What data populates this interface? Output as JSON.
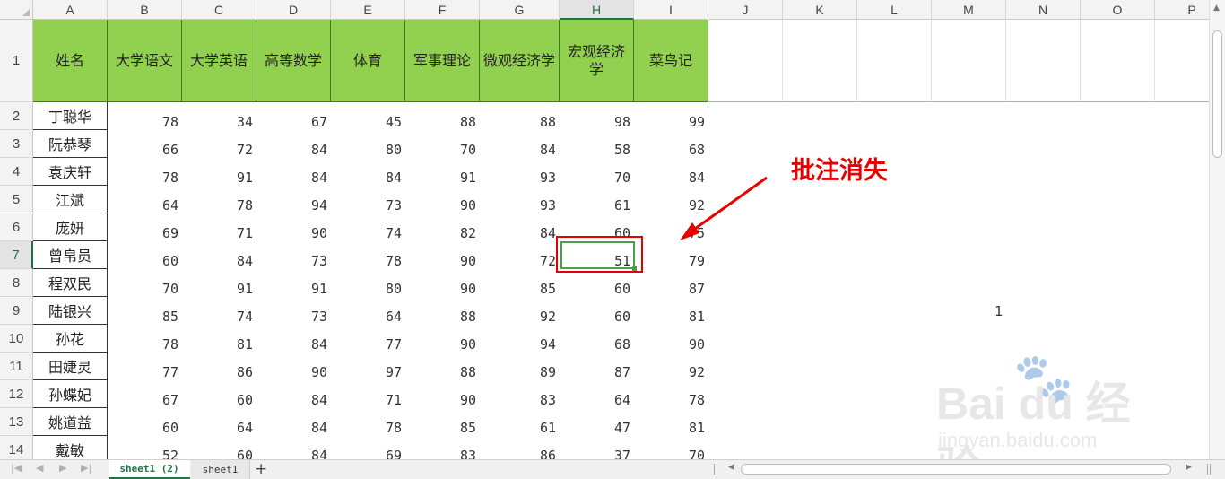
{
  "columns": [
    "A",
    "B",
    "C",
    "D",
    "E",
    "F",
    "G",
    "H",
    "I",
    "J",
    "K",
    "L",
    "M",
    "N",
    "O",
    "P"
  ],
  "active_column": "H",
  "active_row": "7",
  "header_row_number": "1",
  "headers": [
    "姓名",
    "大学语文",
    "大学英语",
    "高等数学",
    "体育",
    "军事理论",
    "微观经济学",
    "宏观经济学",
    "菜鸟记"
  ],
  "rows": [
    {
      "num": "2",
      "name": "丁聪华",
      "scores": [
        "78",
        "34",
        "67",
        "45",
        "88",
        "88",
        "98",
        "99"
      ]
    },
    {
      "num": "3",
      "name": "阮恭琴",
      "scores": [
        "66",
        "72",
        "84",
        "80",
        "70",
        "84",
        "58",
        "68"
      ]
    },
    {
      "num": "4",
      "name": "袁庆轩",
      "scores": [
        "78",
        "91",
        "84",
        "84",
        "91",
        "93",
        "70",
        "84"
      ]
    },
    {
      "num": "5",
      "name": "江斌",
      "scores": [
        "64",
        "78",
        "94",
        "73",
        "90",
        "93",
        "61",
        "92"
      ]
    },
    {
      "num": "6",
      "name": "庞妍",
      "scores": [
        "69",
        "71",
        "90",
        "74",
        "82",
        "84",
        "60",
        "75"
      ]
    },
    {
      "num": "7",
      "name": "曾帛员",
      "scores": [
        "60",
        "84",
        "73",
        "78",
        "90",
        "72",
        "51",
        "79"
      ]
    },
    {
      "num": "8",
      "name": "程双民",
      "scores": [
        "70",
        "91",
        "91",
        "80",
        "90",
        "85",
        "60",
        "87"
      ]
    },
    {
      "num": "9",
      "name": "陆银兴",
      "scores": [
        "85",
        "74",
        "73",
        "64",
        "88",
        "92",
        "60",
        "81"
      ]
    },
    {
      "num": "10",
      "name": "孙花",
      "scores": [
        "78",
        "81",
        "84",
        "77",
        "90",
        "94",
        "68",
        "90"
      ]
    },
    {
      "num": "11",
      "name": "田婕灵",
      "scores": [
        "77",
        "86",
        "90",
        "97",
        "88",
        "89",
        "87",
        "92"
      ]
    },
    {
      "num": "12",
      "name": "孙蝶妃",
      "scores": [
        "67",
        "60",
        "84",
        "71",
        "90",
        "83",
        "64",
        "78"
      ]
    },
    {
      "num": "13",
      "name": "姚道益",
      "scores": [
        "60",
        "64",
        "84",
        "78",
        "85",
        "61",
        "47",
        "81"
      ]
    },
    {
      "num": "14",
      "name": "戴敏",
      "scores": [
        "52",
        "60",
        "84",
        "69",
        "83",
        "86",
        "37",
        "70"
      ]
    }
  ],
  "extra_cell": {
    "row": "9",
    "column": "M",
    "value": "1"
  },
  "annotation": {
    "text": "批注消失",
    "color": "#e60000"
  },
  "sheet_tabs": [
    {
      "label": "sheet1 (2)",
      "active": true
    },
    {
      "label": "sheet1",
      "active": false
    }
  ],
  "add_sheet_label": "+",
  "watermark": {
    "logo": "Bai  du 经验",
    "url": "jingyan.baidu.com"
  },
  "colors": {
    "header_fill": "#92d050",
    "accent": "#217346",
    "highlight": "#e00000"
  }
}
